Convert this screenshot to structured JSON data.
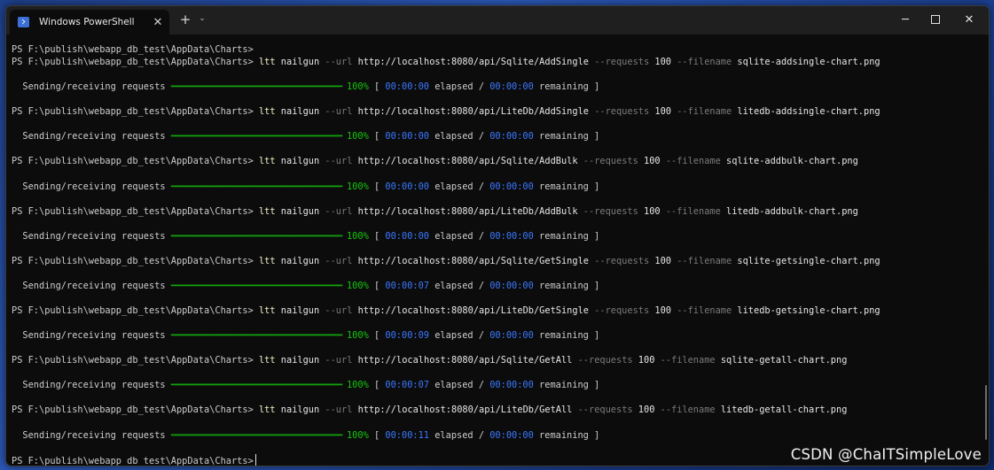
{
  "window": {
    "tab_title": "Windows PowerShell",
    "tab_close": "✕",
    "new_tab": "+",
    "dropdown": "⌄",
    "minimize": "─",
    "close": "✕"
  },
  "terminal": {
    "prompt": "PS F:\\publish\\webapp_db_test\\AppData\\Charts>",
    "progress_label": "Sending/receiving requests",
    "progress_bar": "━━━━━━━━━━━━━━━━━━━━━━━━━━━━━━━━━━━━━━━━",
    "progress_percent": "100%",
    "elapsed_word": "elapsed",
    "remaining_word": "remaining",
    "commands": [
      {
        "cmd": "ltt",
        "tool": "nailgun",
        "url": "http://localhost:8080/api/Sqlite/AddSingle",
        "requests": "100",
        "filename": "sqlite-addsingle-chart.png",
        "elapsed": "00:00:00",
        "remaining": "00:00:00"
      },
      {
        "cmd": "ltt",
        "tool": "nailgun",
        "url": "http://localhost:8080/api/LiteDb/AddSingle",
        "requests": "100",
        "filename": "litedb-addsingle-chart.png",
        "elapsed": "00:00:00",
        "remaining": "00:00:00"
      },
      {
        "cmd": "ltt",
        "tool": "nailgun",
        "url": "http://localhost:8080/api/Sqlite/AddBulk",
        "requests": "100",
        "filename": "sqlite-addbulk-chart.png",
        "elapsed": "00:00:00",
        "remaining": "00:00:00"
      },
      {
        "cmd": "ltt",
        "tool": "nailgun",
        "url": "http://localhost:8080/api/LiteDb/AddBulk",
        "requests": "100",
        "filename": "litedb-addbulk-chart.png",
        "elapsed": "00:00:00",
        "remaining": "00:00:00"
      },
      {
        "cmd": "ltt",
        "tool": "nailgun",
        "url": "http://localhost:8080/api/Sqlite/GetSingle",
        "requests": "100",
        "filename": "sqlite-getsingle-chart.png",
        "elapsed": "00:00:07",
        "remaining": "00:00:00"
      },
      {
        "cmd": "ltt",
        "tool": "nailgun",
        "url": "http://localhost:8080/api/LiteDb/GetSingle",
        "requests": "100",
        "filename": "litedb-getsingle-chart.png",
        "elapsed": "00:00:09",
        "remaining": "00:00:00"
      },
      {
        "cmd": "ltt",
        "tool": "nailgun",
        "url": "http://localhost:8080/api/Sqlite/GetAll",
        "requests": "100",
        "filename": "sqlite-getall-chart.png",
        "elapsed": "00:00:07",
        "remaining": "00:00:00"
      },
      {
        "cmd": "ltt",
        "tool": "nailgun",
        "url": "http://localhost:8080/api/LiteDb/GetAll",
        "requests": "100",
        "filename": "litedb-getall-chart.png",
        "elapsed": "00:00:11",
        "remaining": "00:00:00"
      }
    ],
    "url_flag": "--url",
    "requests_flag": "--requests",
    "filename_flag": "--filename"
  },
  "watermark": "CSDN @ChaITSimpleLove",
  "colors": {
    "terminal_bg": "#0c0c0c",
    "progress_green": "#13a10e",
    "time_blue": "#3b78ff",
    "flag_gray": "#7a7a7a"
  }
}
